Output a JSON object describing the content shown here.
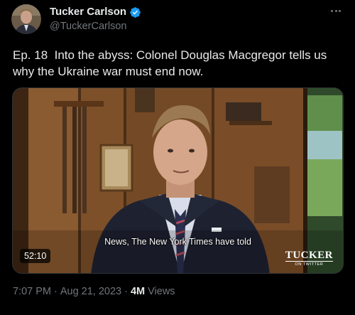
{
  "author": {
    "display_name": "Tucker Carlson",
    "handle": "@TuckerCarlson",
    "verified": true
  },
  "tweet": {
    "text": "Ep. 18  Into the abyss: Colonel Douglas Macgregor tells us why the Ukraine war must end now."
  },
  "video": {
    "caption": "News, The New York Times have told",
    "duration": "52:10",
    "brand_main": "TUCKER",
    "brand_sub": "ON TWITTER"
  },
  "meta": {
    "time": "7:07 PM",
    "separator": "·",
    "date": "Aug 21, 2023",
    "views_count": "4M",
    "views_label": "Views"
  },
  "icons": {
    "verified": "verified-badge-icon",
    "more": "more-options-icon"
  },
  "colors": {
    "background": "#000000",
    "primary_text": "#e7e9ea",
    "secondary_text": "#71767b",
    "verified_blue": "#1d9bf0"
  }
}
